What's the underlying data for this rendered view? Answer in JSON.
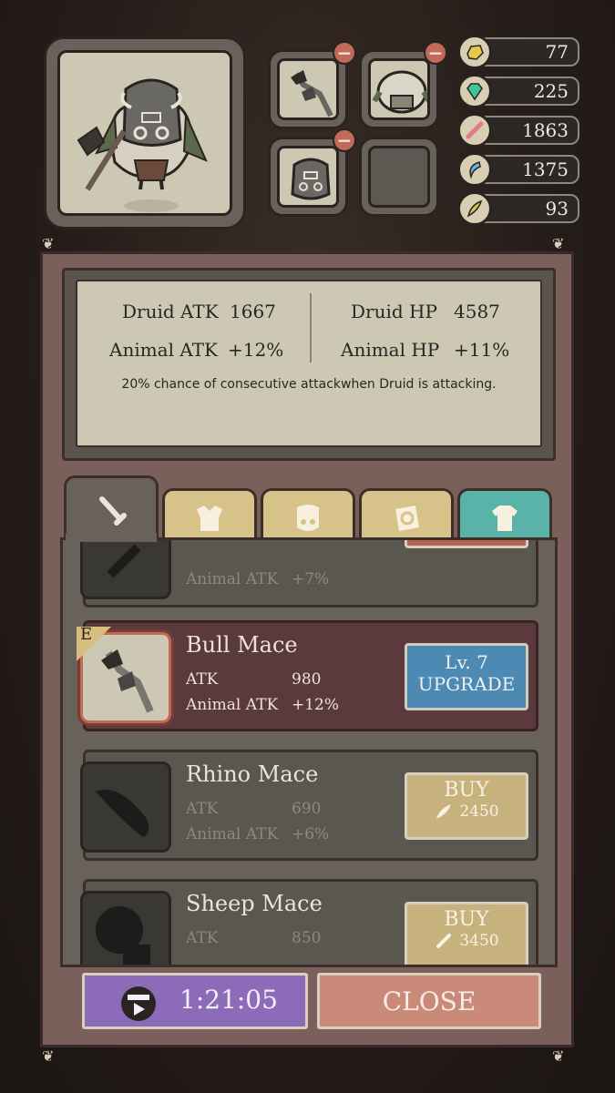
{
  "top_slots": {
    "slot_weapon": "mace-icon",
    "slot_body": "sheep-armor-icon",
    "slot_mask": "boar-mask-icon",
    "slot_empty": ""
  },
  "resources": [
    {
      "icon": "gold-nugget-icon",
      "value": "77",
      "color": "#e8c84a"
    },
    {
      "icon": "gem-icon",
      "value": "225",
      "color": "#3cc79a"
    },
    {
      "icon": "bone-icon",
      "value": "1863",
      "color": "#e07c8a"
    },
    {
      "icon": "claw-icon",
      "value": "1375",
      "color": "#6ab3dc"
    },
    {
      "icon": "feather-icon",
      "value": "93",
      "color": "#d9c44a"
    }
  ],
  "stats": {
    "druid_atk_label": "Druid ATK",
    "druid_atk_value": "1667",
    "druid_hp_label": "Druid HP",
    "druid_hp_value": "4587",
    "animal_atk_label": "Animal ATK",
    "animal_atk_value": "+12%",
    "animal_hp_label": "Animal HP",
    "animal_hp_value": "+11%",
    "description": "20% chance of consecutive attackwhen Druid is attacking."
  },
  "tabs": [
    {
      "icon": "weapon-icon",
      "active": true
    },
    {
      "icon": "armor-icon",
      "active": false
    },
    {
      "icon": "mask-icon",
      "active": false
    },
    {
      "icon": "tattoo-icon",
      "active": false
    },
    {
      "icon": "shirt-icon",
      "active": false
    }
  ],
  "items": [
    {
      "name": "",
      "atk_label": "Animal ATK",
      "atk_value": "+7%"
    },
    {
      "name": "Bull Mace",
      "badge": "E",
      "atk_label": "ATK",
      "atk_value": "980",
      "animal_label": "Animal ATK",
      "animal_value": "+12%",
      "button_line1": "Lv. 7",
      "button_line2": "UPGRADE"
    },
    {
      "name": "Rhino Mace",
      "atk_label": "ATK",
      "atk_value": "690",
      "animal_label": "Animal ATK",
      "animal_value": "+6%",
      "button_label": "BUY",
      "price": "2450",
      "price_icon": "feather-icon"
    },
    {
      "name": "Sheep Mace",
      "atk_label": "ATK",
      "atk_value": "850",
      "button_label": "BUY",
      "price": "3450",
      "price_icon": "bone-icon"
    }
  ],
  "footer": {
    "timer_icon": "video-ad-icon",
    "timer": "1:21:05",
    "close_label": "CLOSE"
  }
}
